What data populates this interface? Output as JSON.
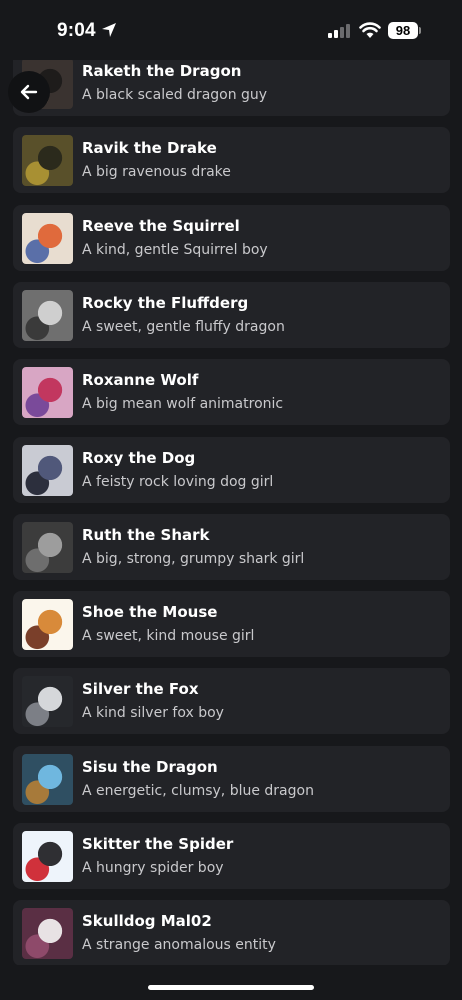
{
  "status_bar": {
    "time": "9:04",
    "battery": "98"
  },
  "characters": [
    {
      "name": "Raketh the Dragon",
      "desc": "A black scaled dragon guy",
      "avatar_colors": [
        "#3a3330",
        "#1e1c1b",
        "#6b5b4d"
      ]
    },
    {
      "name": "Ravik the Drake",
      "desc": "A big ravenous drake",
      "avatar_colors": [
        "#59502a",
        "#2b2a1c",
        "#a89033"
      ]
    },
    {
      "name": "Reeve the Squirrel",
      "desc": "A kind, gentle Squirrel boy",
      "avatar_colors": [
        "#e8ddd0",
        "#e06a3c",
        "#5a6fa8"
      ]
    },
    {
      "name": "Rocky the Fluffderg",
      "desc": "A sweet, gentle fluffy dragon",
      "avatar_colors": [
        "#6f6f6f",
        "#cfcfcf",
        "#3a3a3a"
      ]
    },
    {
      "name": "Roxanne Wolf",
      "desc": "A big mean wolf animatronic",
      "avatar_colors": [
        "#d8a6c4",
        "#c2375f",
        "#7a4a9a"
      ]
    },
    {
      "name": "Roxy the Dog",
      "desc": "A feisty rock loving dog girl",
      "avatar_colors": [
        "#c9cbd3",
        "#50587a",
        "#2c2f3d"
      ]
    },
    {
      "name": "Ruth the Shark",
      "desc": "A big, strong, grumpy shark girl",
      "avatar_colors": [
        "#3c3c3c",
        "#9d9d9d",
        "#6e6e6e"
      ]
    },
    {
      "name": "Shoe the Mouse",
      "desc": "A sweet, kind mouse girl",
      "avatar_colors": [
        "#fbf6ec",
        "#d88a3a",
        "#7a3f2a"
      ]
    },
    {
      "name": "Silver the Fox",
      "desc": "A kind silver fox boy",
      "avatar_colors": [
        "#26282c",
        "#d5d7da",
        "#7c7f86"
      ]
    },
    {
      "name": "Sisu the Dragon",
      "desc": "A energetic, clumsy, blue dragon",
      "avatar_colors": [
        "#2f4f62",
        "#6fb7df",
        "#a77a3a"
      ]
    },
    {
      "name": "Skitter the Spider",
      "desc": "A hungry spider boy",
      "avatar_colors": [
        "#eef4fb",
        "#2f2f33",
        "#d0313b"
      ]
    },
    {
      "name": "Skulldog Mal02",
      "desc": "A strange anomalous entity",
      "avatar_colors": [
        "#5a2f44",
        "#e8e2e4",
        "#8e4a6a"
      ]
    }
  ],
  "icons": {
    "back": "arrow-left-icon",
    "location": "location-arrow-icon",
    "signal": "cellular-signal-icon",
    "wifi": "wifi-icon",
    "battery": "battery-icon"
  }
}
